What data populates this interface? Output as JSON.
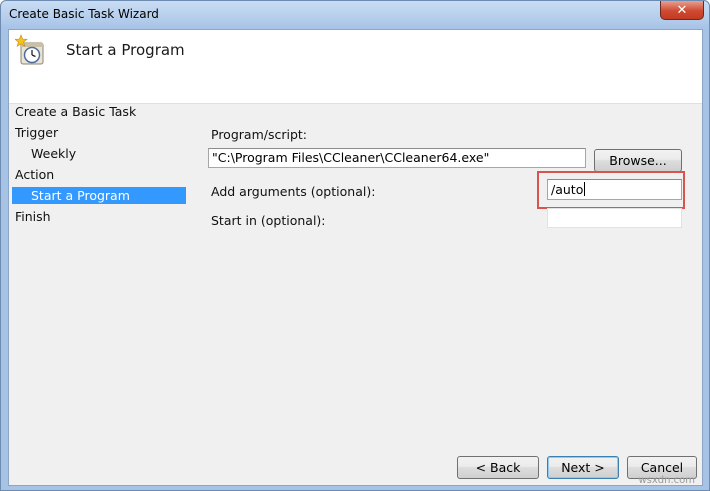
{
  "window": {
    "title": "Create Basic Task Wizard",
    "close_glyph": "✕"
  },
  "header": {
    "title": "Start a Program",
    "icon": "task-scheduler-clock-icon"
  },
  "sidebar": {
    "items": [
      {
        "label": "Create a Basic Task"
      },
      {
        "label": "Trigger"
      },
      {
        "label": "Weekly"
      },
      {
        "label": "Action"
      },
      {
        "label": "Start a Program",
        "selected": true
      },
      {
        "label": "Finish"
      }
    ],
    "selected_color": "#3399ff"
  },
  "form": {
    "program_label": "Program/script:",
    "program_value": "\"C:\\Program Files\\CCleaner\\CCleaner64.exe\"",
    "browse_label": "Browse...",
    "arguments_label": "Add arguments (optional):",
    "arguments_value": "/auto",
    "startin_label": "Start in (optional):",
    "startin_value": ""
  },
  "footer": {
    "back_label": "< Back",
    "next_label": "Next >",
    "cancel_label": "Cancel"
  },
  "annotation": {
    "highlight_color": "#d9534f"
  },
  "watermark": "wsxdn.com"
}
